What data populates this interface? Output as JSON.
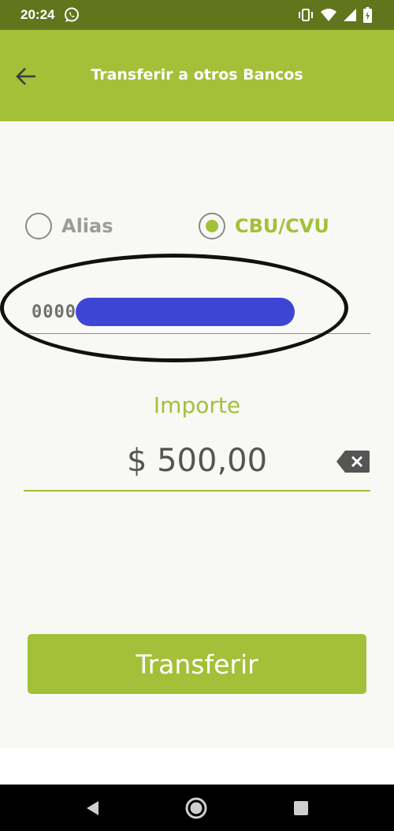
{
  "status_bar": {
    "time": "20:24",
    "icons": [
      "whatsapp-icon",
      "vibrate-icon",
      "wifi-icon",
      "signal-icon",
      "battery-icon"
    ]
  },
  "app_bar": {
    "title": "Transferir a otros Bancos",
    "back_icon": "arrow-left-icon"
  },
  "destination": {
    "options": [
      {
        "label": "Alias",
        "selected": false
      },
      {
        "label": "CBU/CVU",
        "selected": true
      }
    ],
    "account_value_visible": "0000"
  },
  "amount": {
    "label": "Importe",
    "value": "$ 500,00"
  },
  "actions": {
    "transfer_label": "Transferir"
  },
  "colors": {
    "accent": "#a3c038",
    "status_bar": "#61761c",
    "background": "#f8f8f4",
    "redaction": "#3d46d4"
  },
  "nav_bar": {
    "icons": [
      "back-triangle-icon",
      "home-circle-icon",
      "recents-square-icon"
    ]
  }
}
